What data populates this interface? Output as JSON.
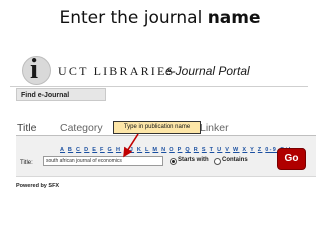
{
  "slide": {
    "title_prefix": "Enter the journal ",
    "title_bold": "name"
  },
  "header": {
    "logo_letter": "i",
    "logo_text": "UCT LIBRARIES",
    "portal_title": "e-Journal Portal"
  },
  "find_bar": {
    "label": "Find e-Journal"
  },
  "tabs": [
    {
      "label": "Title"
    },
    {
      "label": "Category"
    },
    {
      "label": "Linker"
    }
  ],
  "search": {
    "field_label": "Title:",
    "input_value": "south african journal of economics",
    "az_letters": [
      "A",
      "B",
      "C",
      "D",
      "E",
      "F",
      "G",
      "H",
      "I",
      "J",
      "K",
      "L",
      "M",
      "N",
      "O",
      "P",
      "Q",
      "R",
      "S",
      "T",
      "U",
      "V",
      "W",
      "X",
      "Y",
      "Z",
      "0-9",
      "Others"
    ],
    "radio_starts": "Starts with",
    "radio_contains": "Contains",
    "go_label": "Go"
  },
  "callout": {
    "text": "Type in publication name"
  },
  "footer": {
    "powered_by": "Powered by SFX"
  },
  "colors": {
    "go_button": "#b00000",
    "callout_bg": "#fde6a8",
    "az_link": "#1a4fa0"
  }
}
